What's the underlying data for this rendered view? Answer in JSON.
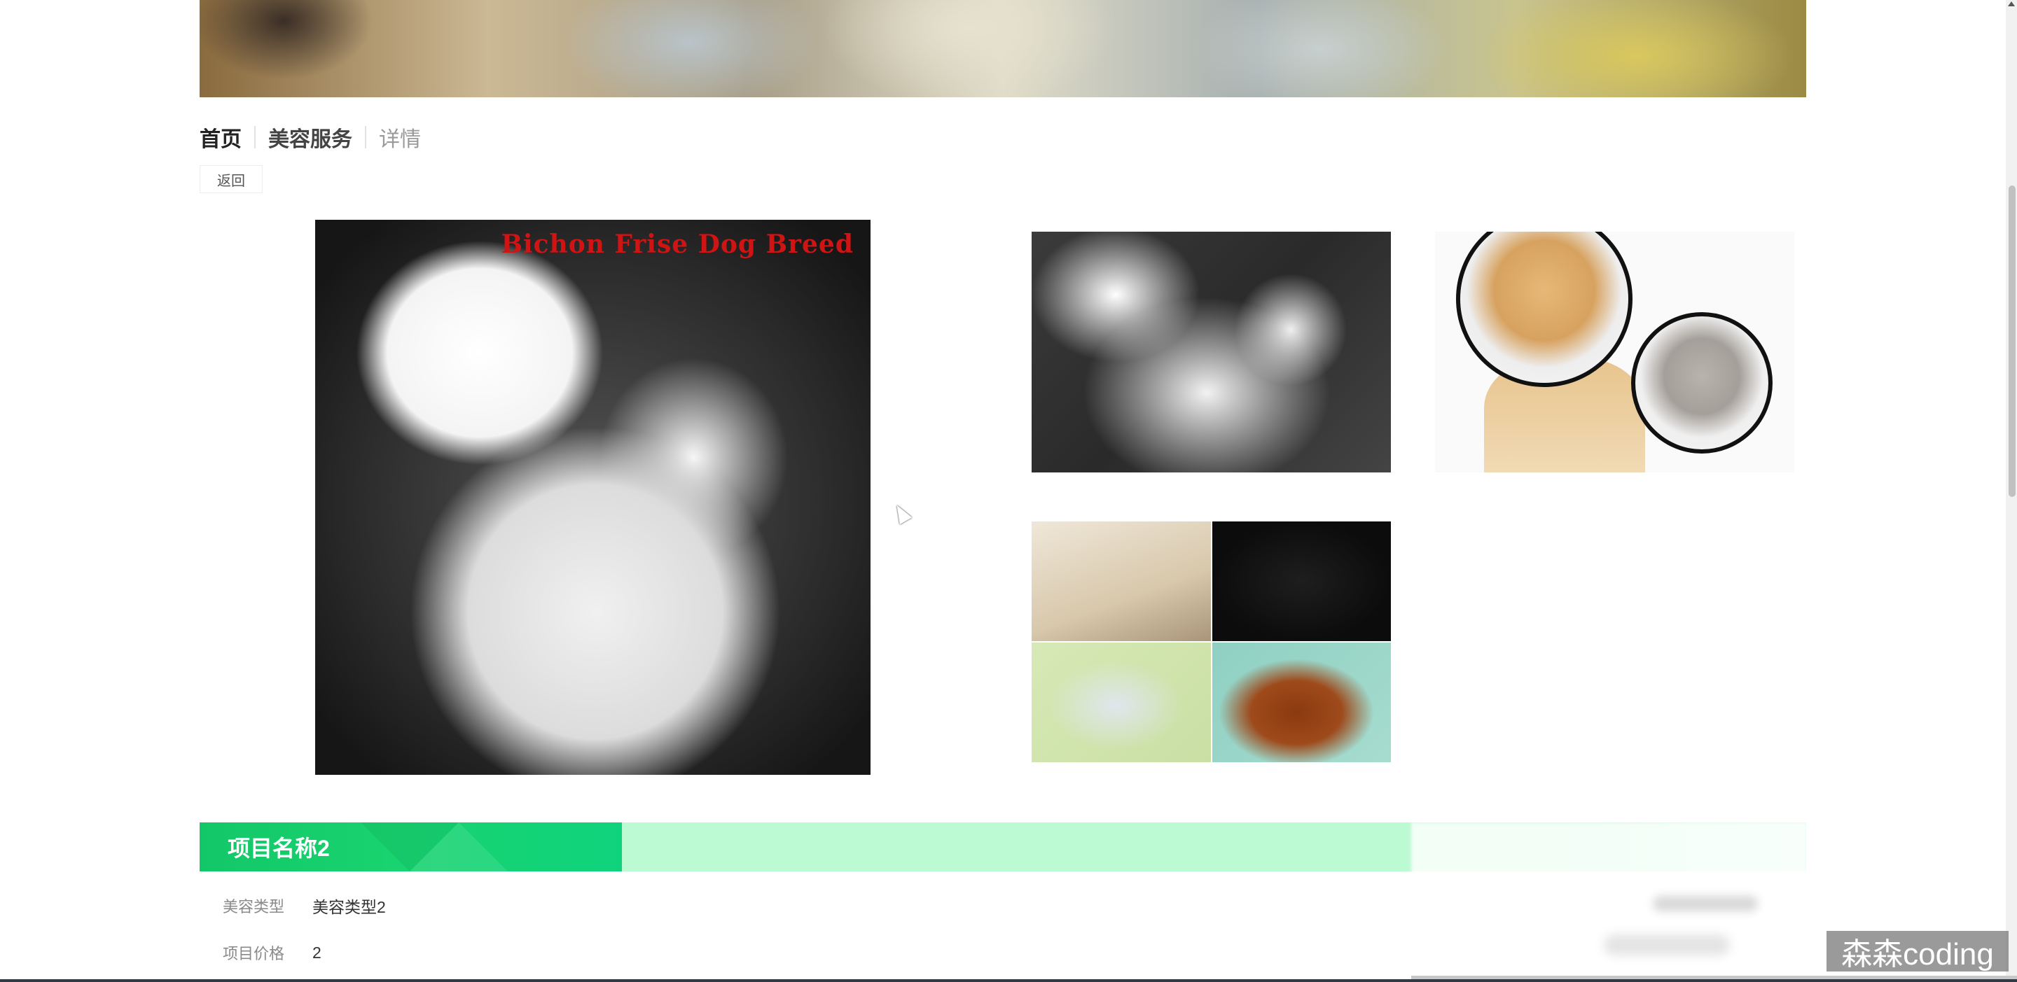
{
  "breadcrumb": {
    "home": "首页",
    "section": "美容服务",
    "current": "详情"
  },
  "back_button": "返回",
  "main_image": {
    "caption": "Bichon Frise Dog Breed"
  },
  "detail": {
    "title": "项目名称2",
    "fields": [
      {
        "label": "美容类型",
        "value": "美容类型2"
      },
      {
        "label": "项目价格",
        "value": "2"
      }
    ]
  },
  "watermark": "森森coding",
  "colors": {
    "title_tab": "#12c768",
    "title_bar": "#bcfad4",
    "caption": "#d01414"
  }
}
